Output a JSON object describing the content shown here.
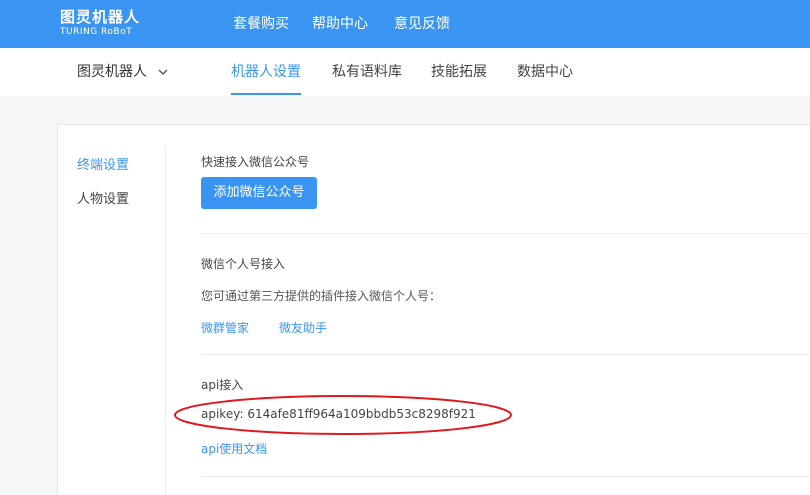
{
  "header": {
    "logo_cn": "图灵机器人",
    "logo_en": "TURING RoBoT",
    "nav": [
      "套餐购买",
      "帮助中心",
      "意见反馈"
    ]
  },
  "subheader": {
    "robot_name": "图灵机器人",
    "tabs": [
      "机器人设置",
      "私有语料库",
      "技能拓展",
      "数据中心"
    ],
    "active_tab": "机器人设置"
  },
  "sidebar": {
    "items": [
      "终端设置",
      "人物设置"
    ],
    "active_item": "终端设置"
  },
  "wechat_official": {
    "title": "快速接入微信公众号",
    "button_label": "添加微信公众号"
  },
  "wechat_personal": {
    "title": "微信个人号接入",
    "description": "您可通过第三方提供的插件接入微信个人号：",
    "links": [
      "微群管家",
      "微友助手"
    ]
  },
  "api": {
    "title": "api接入",
    "apikey_label": "apikey:",
    "apikey_value": "614afe81ff964a109bbdb53c8298f921",
    "doc_link": "api使用文档"
  },
  "colors": {
    "brand": "#3a95f2",
    "annotation": "#e0191f"
  }
}
